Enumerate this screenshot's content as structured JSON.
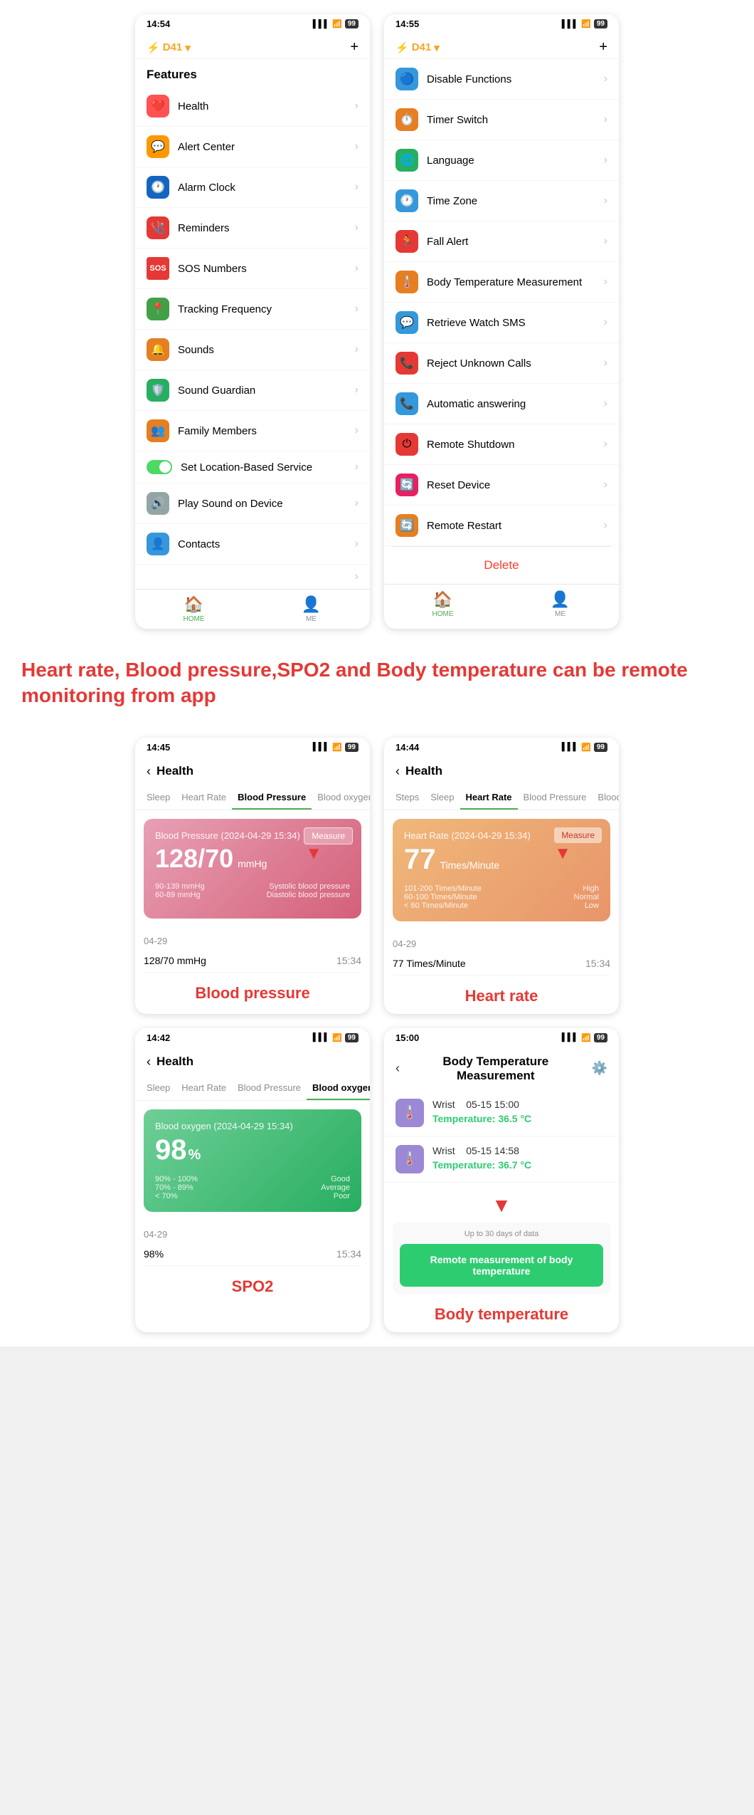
{
  "phones": [
    {
      "id": "phone1",
      "statusBar": {
        "time": "14:54",
        "signal": "▌▌▌",
        "wifi": "WiFi",
        "battery": "99"
      },
      "header": {
        "device": "D41",
        "icon": "⚡"
      },
      "sectionTitle": "Features",
      "menuItems": [
        {
          "id": "health",
          "icon": "❤️",
          "iconBg": "#ff5252",
          "label": "Health"
        },
        {
          "id": "alert",
          "icon": "💬",
          "iconBg": "#ff9800",
          "label": "Alert Center"
        },
        {
          "id": "alarm",
          "icon": "🕐",
          "iconBg": "#1565c0",
          "label": "Alarm Clock"
        },
        {
          "id": "reminders",
          "icon": "🩺",
          "iconBg": "#e53935",
          "label": "Reminders"
        },
        {
          "id": "sos",
          "icon": "🆘",
          "iconBg": "#e53935",
          "label": "SOS Numbers"
        },
        {
          "id": "tracking",
          "icon": "📍",
          "iconBg": "#43a047",
          "label": "Tracking Frequency"
        },
        {
          "id": "sounds",
          "icon": "🔔",
          "iconBg": "#e67e22",
          "label": "Sounds"
        },
        {
          "id": "soundguardian",
          "icon": "🛡️",
          "iconBg": "#27ae60",
          "label": "Sound Guardian"
        },
        {
          "id": "family",
          "icon": "👥",
          "iconBg": "#e67e22",
          "label": "Family Members"
        },
        {
          "id": "location",
          "icon": "toggle",
          "label": "Set Location-Based Service"
        },
        {
          "id": "playsound",
          "icon": "🔊",
          "iconBg": "#95a5a6",
          "label": "Play Sound on Device"
        },
        {
          "id": "contacts",
          "icon": "👤",
          "iconBg": "#3498db",
          "label": "Contacts"
        }
      ],
      "nav": [
        {
          "id": "home",
          "icon": "🏠",
          "label": "HOME",
          "active": true
        },
        {
          "id": "me",
          "icon": "👤",
          "label": "ME",
          "active": false
        }
      ]
    },
    {
      "id": "phone2",
      "statusBar": {
        "time": "14:55",
        "signal": "▌▌▌",
        "wifi": "WiFi",
        "battery": "99"
      },
      "header": {
        "device": "D41",
        "icon": "⚡"
      },
      "menuItems": [
        {
          "id": "disable",
          "icon": "🔵",
          "iconBg": "#3498db",
          "label": "Disable Functions"
        },
        {
          "id": "timer",
          "icon": "⏱️",
          "iconBg": "#e67e22",
          "label": "Timer Switch"
        },
        {
          "id": "language",
          "icon": "🌐",
          "iconBg": "#27ae60",
          "label": "Language"
        },
        {
          "id": "timezone",
          "icon": "🕐",
          "iconBg": "#3498db",
          "label": "Time Zone"
        },
        {
          "id": "fallalert",
          "icon": "🏃",
          "iconBg": "#e53935",
          "label": "Fall Alert"
        },
        {
          "id": "bodytemp",
          "icon": "🌡️",
          "iconBg": "#e67e22",
          "label": "Body Temperature Measurement"
        },
        {
          "id": "retrievesms",
          "icon": "💬",
          "iconBg": "#3498db",
          "label": "Retrieve Watch SMS"
        },
        {
          "id": "rejectcalls",
          "icon": "📞",
          "iconBg": "#e53935",
          "label": "Reject Unknown Calls"
        },
        {
          "id": "autoanswer",
          "icon": "📞",
          "iconBg": "#3498db",
          "label": "Automatic answering"
        },
        {
          "id": "shutdown",
          "icon": "⏻",
          "iconBg": "#e53935",
          "label": "Remote Shutdown"
        },
        {
          "id": "resetdevice",
          "icon": "🔄",
          "iconBg": "#e91e63",
          "label": "Reset Device"
        },
        {
          "id": "remoterestart",
          "icon": "🔄",
          "iconBg": "#e67e22",
          "label": "Remote Restart"
        }
      ],
      "deleteLabel": "Delete",
      "nav": [
        {
          "id": "home",
          "icon": "🏠",
          "label": "HOME",
          "active": true
        },
        {
          "id": "me",
          "icon": "👤",
          "label": "ME",
          "active": false
        }
      ]
    }
  ],
  "banner": {
    "text": "Heart rate, Blood pressure,SPO2 and Body temperature can be remote monitoring from app"
  },
  "healthScreens": [
    {
      "id": "bloodpressure",
      "statusBar": {
        "time": "14:45",
        "battery": "99"
      },
      "title": "Health",
      "tabs": [
        "Sleep",
        "Heart Rate",
        "Blood Pressure",
        "Blood oxygen"
      ],
      "activeTab": "Blood Pressure",
      "card": {
        "type": "bp",
        "title": "Blood Pressure   (2024-04-29 15:34)",
        "value": "128/70",
        "unit": "mmHg",
        "measureLabel": "Measure",
        "ranges": [
          {
            "range": "90-139 mmHg",
            "label": "Systolic blood pressure"
          },
          {
            "range": "60-89 mmHg",
            "label": "Diastolic blood pressure"
          }
        ]
      },
      "dataDate": "04-29",
      "dataRows": [
        {
          "value": "128/70 mmHg",
          "time": "15:34"
        }
      ],
      "screenLabel": "Blood pressure"
    },
    {
      "id": "heartrate",
      "statusBar": {
        "time": "14:44",
        "battery": "99"
      },
      "title": "Health",
      "tabs": [
        "Steps",
        "Sleep",
        "Heart Rate",
        "Blood Pressure",
        "Blood o"
      ],
      "activeTab": "Heart Rate",
      "card": {
        "type": "hr",
        "title": "Heart Rate   (2024-04-29 15:34)",
        "value": "77",
        "unit": "Times/Minute",
        "measureLabel": "Measure",
        "ranges": [
          {
            "range": "101-200 Times/Minute",
            "label": "High"
          },
          {
            "range": "60-100 Times/Minute",
            "label": "Normal"
          },
          {
            "range": "< 60 Times/Minute",
            "label": "Low"
          }
        ]
      },
      "dataDate": "04-29",
      "dataRows": [
        {
          "value": "77 Times/Minute",
          "time": "15:34"
        }
      ],
      "screenLabel": "Heart rate"
    }
  ],
  "healthScreens2": [
    {
      "id": "spo2",
      "statusBar": {
        "time": "14:42",
        "battery": "99"
      },
      "title": "Health",
      "tabs": [
        "Sleep",
        "Heart Rate",
        "Blood Pressure",
        "Blood oxygen"
      ],
      "activeTab": "Blood oxygen",
      "card": {
        "type": "o2",
        "title": "Blood oxygen   (2024-04-29 15:34)",
        "value": "98",
        "unit": "%",
        "ranges": [
          {
            "range": "90% - 100%",
            "label": "Good"
          },
          {
            "range": "70% - 89%",
            "label": "Average"
          },
          {
            "range": "< 70%",
            "label": "Poor"
          }
        ]
      },
      "dataDate": "04-29",
      "dataRows": [
        {
          "value": "98%",
          "time": "15:34"
        }
      ],
      "screenLabel": "SPO2"
    },
    {
      "id": "bodytemp",
      "statusBar": {
        "time": "15:00",
        "battery": "99"
      },
      "title": "Body Temperature Measurement",
      "tempItems": [
        {
          "location": "Wrist",
          "date": "05-15 15:00",
          "temp": "Temperature: 36.5 °C"
        },
        {
          "location": "Wrist",
          "date": "05-15 14:58",
          "temp": "Temperature: 36.7 °C"
        }
      ],
      "remoteNote": "Up to 30 days of data",
      "remoteBtn": "Remote measurement of body temperature",
      "screenLabel": "Body temperature"
    }
  ]
}
